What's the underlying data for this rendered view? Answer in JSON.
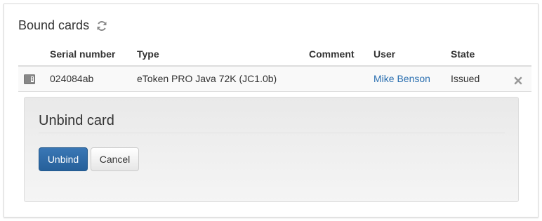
{
  "bound_cards": {
    "title": "Bound cards",
    "refresh_icon": "refresh-icon",
    "columns": [
      "Serial number",
      "Type",
      "Comment",
      "User",
      "State"
    ],
    "rows": [
      {
        "icon": "card-reader-icon",
        "serial": "024084ab",
        "type": "eToken PRO Java 72K (JC1.0b)",
        "comment": "",
        "user": "Mike Benson",
        "state": "Issued",
        "action_icon": "remove-icon"
      }
    ]
  },
  "unbind_dialog": {
    "title": "Unbind card",
    "confirm_label": "Unbind",
    "cancel_label": "Cancel"
  },
  "colors": {
    "link": "#2a6fb0",
    "primary": "#2f6ba8",
    "icon_gray": "#888888"
  }
}
